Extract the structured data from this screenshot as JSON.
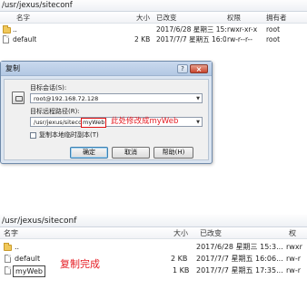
{
  "top_panel": {
    "path": "/usr/jexus/siteconf",
    "columns": {
      "name": "名字",
      "size": "大小",
      "modified": "已改变",
      "permissions": "权限",
      "owner": "拥有者"
    },
    "rows": [
      {
        "name": "..",
        "size": "",
        "modified": "2017/6/28 星期三 15:3...",
        "permissions": "rwxr-xr-x",
        "owner": "root",
        "icon": "folder-up-icon"
      },
      {
        "name": "default",
        "size": "2 KB",
        "modified": "2017/7/7 星期五 16:06...",
        "permissions": "rw-r--r--",
        "owner": "root",
        "icon": "file-icon"
      }
    ]
  },
  "dialog": {
    "title": "复制",
    "help_label": "?",
    "close_label": "×",
    "target_session_label": "目标会话(S):",
    "target_session_value": "root@192.168.72.128",
    "target_path_label": "目标远程路径(R):",
    "target_path_prefix": "/usr/jexus/siteconf/",
    "target_path_name": "myWeb",
    "annotation": "此处修改成myWeb",
    "copy_to_local_label": "复制本地临时副本(T)",
    "ok_label": "确定",
    "cancel_label": "取消",
    "help_button_label": "帮助(H)"
  },
  "bottom_panel": {
    "path": "/usr/jexus/siteconf",
    "columns": {
      "name": "名字",
      "size": "大小",
      "modified": "已改变",
      "permissions": "权"
    },
    "rows": [
      {
        "name": "..",
        "size": "",
        "modified": "2017/6/28 星期三 15:3...",
        "permissions": "rwxr",
        "icon": "folder-up-icon"
      },
      {
        "name": "default",
        "size": "2 KB",
        "modified": "2017/7/7 星期五 16:06...",
        "permissions": "rw-r",
        "icon": "file-icon"
      },
      {
        "name": "myWeb",
        "size": "1 KB",
        "modified": "2017/7/7 星期五 17:35...",
        "permissions": "rw-r",
        "icon": "file-icon"
      }
    ],
    "annotation": "复制完成"
  },
  "colors": {
    "annotation_red": "#e51c23",
    "dialog_bg": "#dbe5f1"
  }
}
